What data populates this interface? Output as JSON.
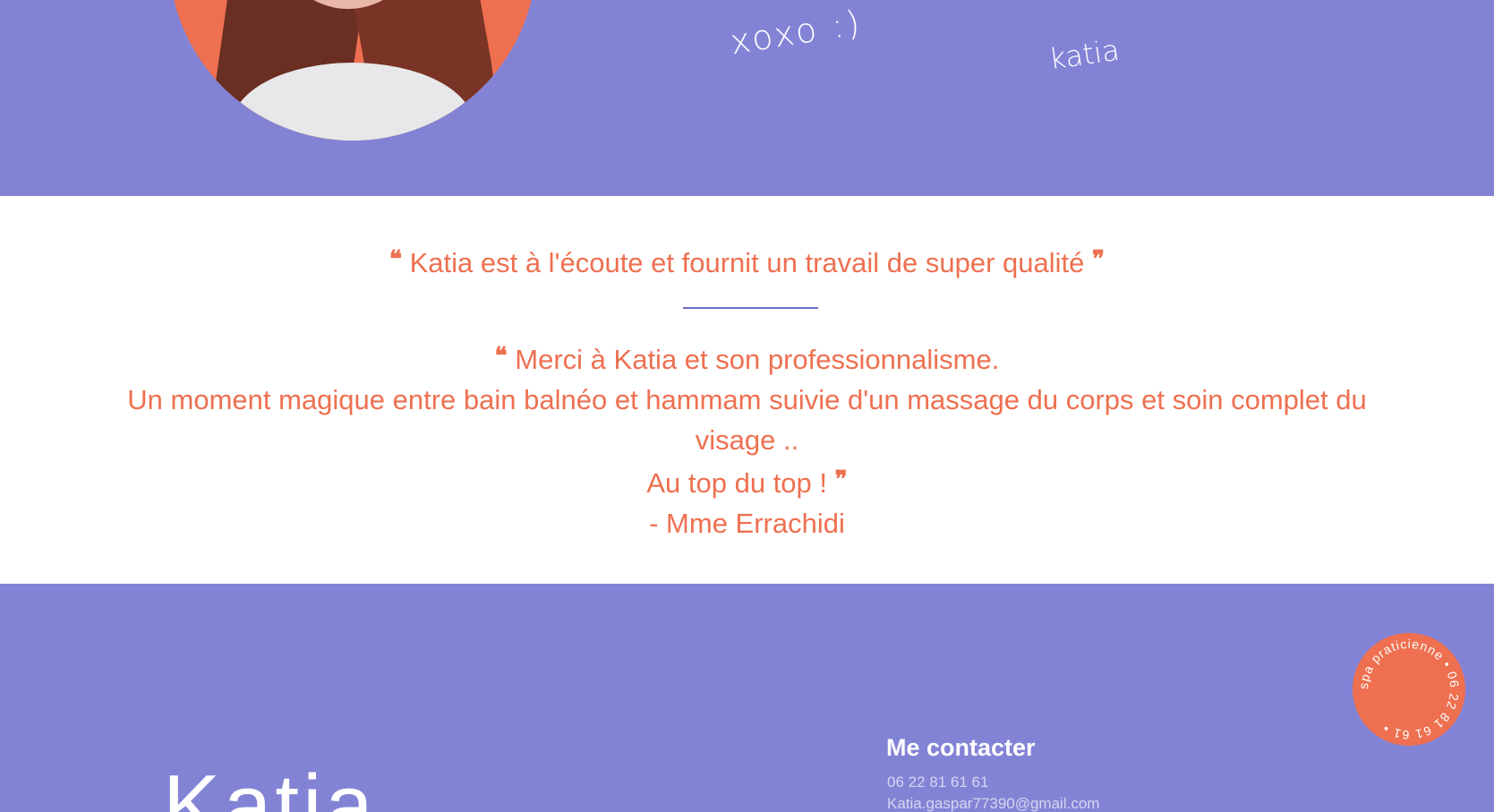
{
  "hero": {
    "xoxo": "xoxo :)",
    "signature": "katia"
  },
  "testimonials": {
    "open_quote": "❝",
    "close_quote": "❞",
    "quote1": "Katia est à l'écoute et fournit un travail de super qualité",
    "quote2_line1": "Merci à Katia et son professionnalisme.",
    "quote2_line2": "Un moment magique entre bain balnéo et hammam suivie d'un massage du corps et soin complet du visage ..",
    "quote2_line3": "Au top du top !",
    "quote2_author": "- Mme Errachidi"
  },
  "footer": {
    "brand": "Katia",
    "contact_title": "Me contacter",
    "phone": "06 22 81 61 61",
    "email": "Katia.gaspar77390@gmail.com",
    "badge_text": "spa praticienne • 06 22 81 61 61 • "
  },
  "colors": {
    "lavender": "#8383d6",
    "coral": "#ee7050",
    "divider": "#6b6bc7"
  }
}
